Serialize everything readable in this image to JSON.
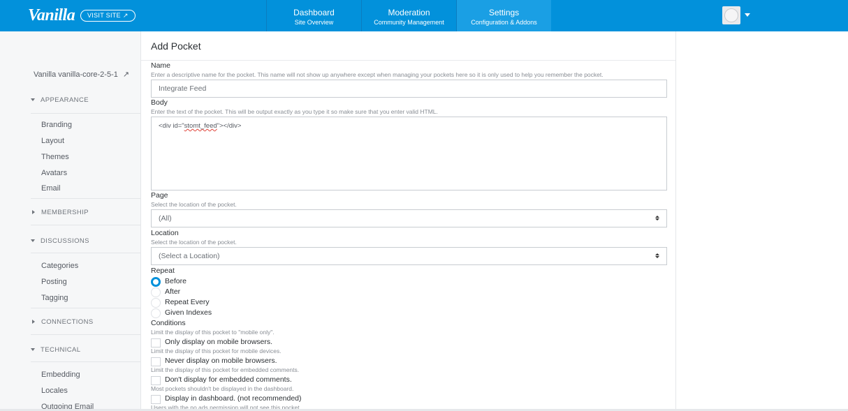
{
  "header": {
    "logo": "Vanilla",
    "visit_site": "VISIT SITE",
    "tabs": [
      {
        "label": "Dashboard",
        "sub": "Site Overview"
      },
      {
        "label": "Moderation",
        "sub": "Community Management"
      },
      {
        "label": "Settings",
        "sub": "Configuration & Addons"
      }
    ]
  },
  "sidebar": {
    "site_link": "Vanilla vanilla-core-2-5-1",
    "sections": [
      {
        "label": "APPEARANCE",
        "items": [
          "Branding",
          "Layout",
          "Themes",
          "Avatars",
          "Email"
        ]
      },
      {
        "label": "MEMBERSHIP"
      },
      {
        "label": "DISCUSSIONS",
        "items": [
          "Categories",
          "Posting",
          "Tagging"
        ]
      },
      {
        "label": "CONNECTIONS"
      },
      {
        "label": "TECHNICAL",
        "items": [
          "Embedding",
          "Locales",
          "Outgoing Email"
        ]
      }
    ]
  },
  "form": {
    "title": "Add Pocket",
    "name": {
      "label": "Name",
      "desc": "Enter a descriptive name for the pocket. This name will not show up anywhere except when managing your pockets here so it is only used to help you remember the pocket.",
      "value": "Integrate Feed"
    },
    "body": {
      "label": "Body",
      "desc": "Enter the text of the pocket. This will be output exactly as you type it so make sure that you enter valid HTML.",
      "value_pre": "<div id=\"",
      "value_mid": "stomt_feed",
      "value_post": "\"></div>"
    },
    "page": {
      "label": "Page",
      "desc": "Select the location of the pocket.",
      "value": "(All)"
    },
    "location": {
      "label": "Location",
      "desc": "Select the location of the pocket.",
      "value": "(Select a Location)"
    },
    "repeat": {
      "label": "Repeat",
      "options": [
        "Before",
        "After",
        "Repeat Every",
        "Given Indexes"
      ],
      "selected": "Before"
    },
    "conditions": {
      "label": "Conditions",
      "items": [
        {
          "desc": "Limit the display of this pocket to \"mobile only\".",
          "label": "Only display on mobile browsers."
        },
        {
          "desc": "Limit the display of this pocket for mobile devices.",
          "label": "Never display on mobile browsers."
        },
        {
          "desc": "Limit the display of this pocket for embedded comments.",
          "label": "Don't display for embedded comments."
        },
        {
          "desc": "Most pockets shouldn't be displayed in the dashboard.",
          "label": "Display in dashboard. (not recommended)"
        }
      ],
      "trailing_desc": "Users with the no ads permission will not see this pocket."
    }
  },
  "colors": {
    "accent": "#0291db",
    "sidebar_bg": "#f6f7f8"
  }
}
